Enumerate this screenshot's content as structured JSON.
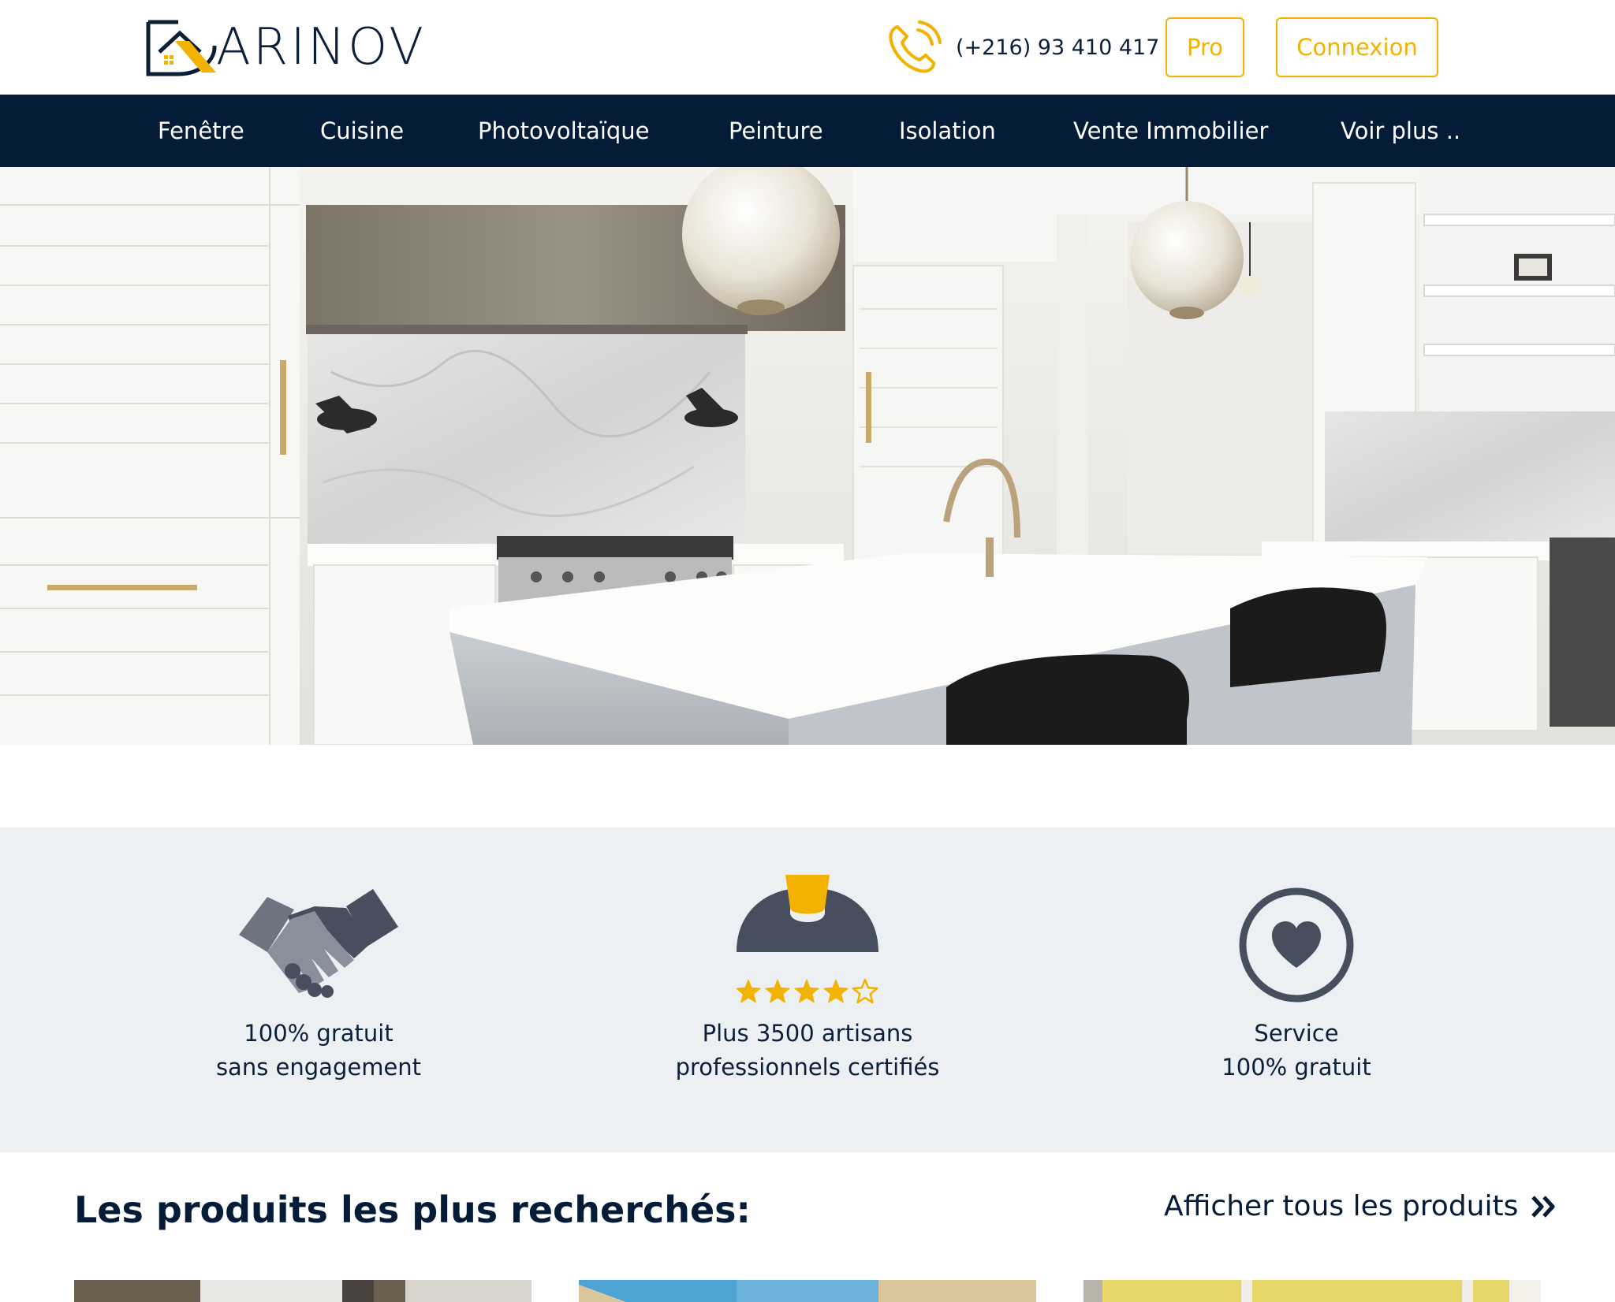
{
  "header": {
    "logo_text": "ARINOV",
    "phone": "(+216) 93 410 417",
    "pro_label": "Pro",
    "connexion_label": "Connexion"
  },
  "nav": {
    "items": [
      {
        "label": "Fenêtre"
      },
      {
        "label": "Cuisine"
      },
      {
        "label": "Photovoltaïque"
      },
      {
        "label": "Peinture"
      },
      {
        "label": "Isolation"
      },
      {
        "label": "Vente Immobilier"
      },
      {
        "label": "Voir plus .."
      }
    ]
  },
  "features": [
    {
      "icon": "handshake-icon",
      "line1": "100% gratuit",
      "line2": "sans engagement"
    },
    {
      "icon": "hard-hat-icon",
      "rating": 4,
      "rating_max": 5,
      "line1": "Plus 3500 artisans",
      "line2": "professionnels certifiés"
    },
    {
      "icon": "heart-circle-icon",
      "line1": "Service",
      "line2": "100% gratuit"
    }
  ],
  "products": {
    "title": "Les produits les plus recherchés:",
    "see_all": "Afficher tous les produits"
  },
  "colors": {
    "accent": "#f2b200",
    "navy": "#041c38",
    "icon_gray": "#474e5e",
    "features_bg": "#edf0f3"
  }
}
